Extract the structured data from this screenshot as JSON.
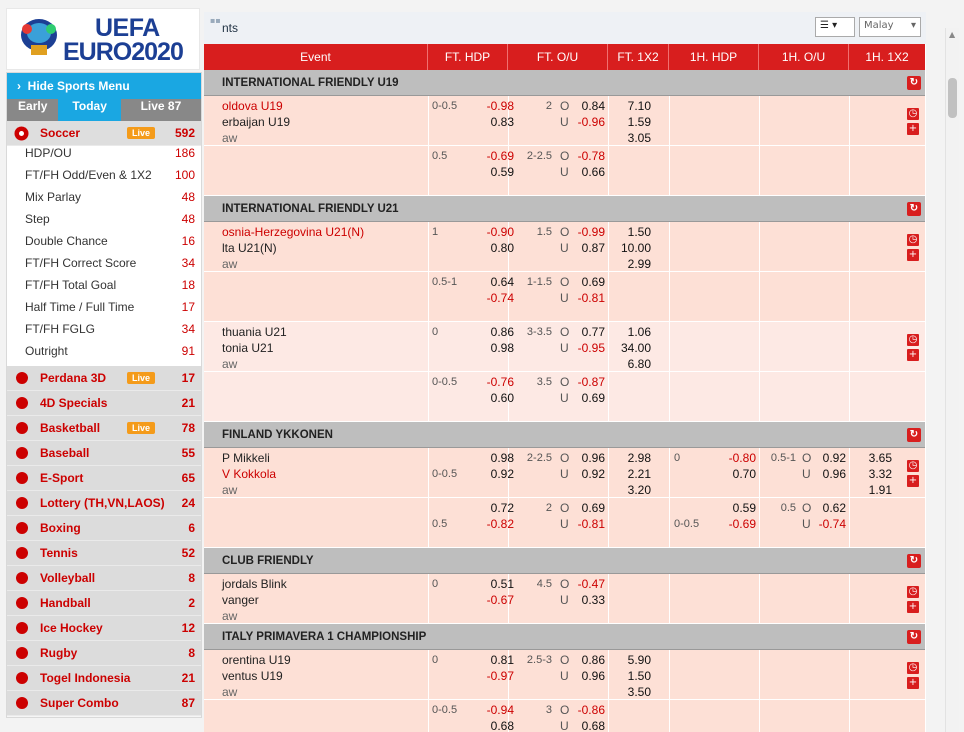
{
  "logo": {
    "line1": "UEFA",
    "line2": "EURO2020"
  },
  "sidebar": {
    "hide_label": "Hide Sports Menu",
    "tabs": [
      {
        "label": "Early"
      },
      {
        "label": "Today"
      },
      {
        "label": "Live 87"
      }
    ],
    "soccer": {
      "name": "Soccer",
      "live": "Live",
      "count": "592"
    },
    "sub": [
      {
        "label": "HDP/OU",
        "count": "186"
      },
      {
        "label": "FT/FH Odd/Even & 1X2",
        "count": "100"
      },
      {
        "label": "Mix Parlay",
        "count": "48"
      },
      {
        "label": "Step",
        "count": "48"
      },
      {
        "label": "Double Chance",
        "count": "16"
      },
      {
        "label": "FT/FH Correct Score",
        "count": "34"
      },
      {
        "label": "FT/FH Total Goal",
        "count": "18"
      },
      {
        "label": "Half Time / Full Time",
        "count": "17"
      },
      {
        "label": "FT/FH FGLG",
        "count": "34"
      },
      {
        "label": "Outright",
        "count": "91"
      }
    ],
    "sports": [
      {
        "name": "Perdana 3D",
        "live": "Live",
        "count": "17"
      },
      {
        "name": "4D Specials",
        "live": "",
        "count": "21"
      },
      {
        "name": "Basketball",
        "live": "Live",
        "count": "78"
      },
      {
        "name": "Baseball",
        "live": "",
        "count": "55"
      },
      {
        "name": "E-Sport",
        "live": "",
        "count": "65"
      },
      {
        "name": "Lottery (TH,VN,LAOS)",
        "live": "",
        "count": "24"
      },
      {
        "name": "Boxing",
        "live": "",
        "count": "6"
      },
      {
        "name": "Tennis",
        "live": "",
        "count": "52"
      },
      {
        "name": "Volleyball",
        "live": "",
        "count": "8"
      },
      {
        "name": "Handball",
        "live": "",
        "count": "2"
      },
      {
        "name": "Ice Hockey",
        "live": "",
        "count": "12"
      },
      {
        "name": "Rugby",
        "live": "",
        "count": "8"
      },
      {
        "name": "Togel Indonesia",
        "live": "",
        "count": "21"
      },
      {
        "name": "Super Combo",
        "live": "",
        "count": "87"
      }
    ]
  },
  "topbar": {
    "title": "nts",
    "odds_type": "Malay"
  },
  "columns": [
    "Event",
    "FT. HDP",
    "FT. O/U",
    "FT. 1X2",
    "1H. HDP",
    "1H. O/U",
    "1H. 1X2"
  ],
  "leagues": [
    {
      "name": "INTERNATIONAL FRIENDLY U19",
      "rows": [
        {
          "t1": "oldova U19",
          "t1fav": true,
          "t2": "erbaijan U19",
          "t3": "aw",
          "hdp": "0-0.5",
          "h1": "-0.98",
          "h2": "0.83",
          "ou": "2",
          "o1": "0.84",
          "o2": "-0.96",
          "x1": "7.10",
          "x2": "1.59",
          "x3": "3.05",
          "icons": true
        },
        {
          "t1": "",
          "t2": "",
          "t3": "",
          "hdp": "0.5",
          "h1": "-0.69",
          "h2": "0.59",
          "ou": "2-2.5",
          "o1": "-0.78",
          "o2": "0.66",
          "x1": "",
          "x2": "",
          "x3": ""
        }
      ]
    },
    {
      "name": "INTERNATIONAL FRIENDLY U21",
      "rows": [
        {
          "t1": "osnia-Herzegovina U21(N)",
          "t1fav": true,
          "t2": "lta U21(N)",
          "t3": "aw",
          "hdp": "1",
          "h1": "-0.90",
          "h2": "0.80",
          "ou": "1.5",
          "o1": "-0.99",
          "o2": "0.87",
          "x1": "1.50",
          "x2": "10.00",
          "x3": "2.99",
          "icons": true
        },
        {
          "t1": "",
          "t2": "",
          "t3": "",
          "hdp": "0.5-1",
          "h1": "0.64",
          "h2": "-0.74",
          "ou": "1-1.5",
          "o1": "0.69",
          "o2": "-0.81",
          "x1": "",
          "x2": "",
          "x3": ""
        },
        {
          "t1": "thuania U21",
          "t2": "tonia U21",
          "t3": "aw",
          "hdp": "0",
          "h1": "0.86",
          "h2": "0.98",
          "ou": "3-3.5",
          "o1": "0.77",
          "o2": "-0.95",
          "x1": "1.06",
          "x2": "34.00",
          "x3": "6.80",
          "icons": true,
          "light": true
        },
        {
          "t1": "",
          "t2": "",
          "t3": "",
          "hdp": "0-0.5",
          "h1": "-0.76",
          "h2": "0.60",
          "ou": "3.5",
          "o1": "-0.87",
          "o2": "0.69",
          "x1": "",
          "x2": "",
          "x3": "",
          "light": true
        }
      ]
    },
    {
      "name": "FINLAND YKKONEN",
      "rows": [
        {
          "t1": "P Mikkeli",
          "t2": "V Kokkola",
          "t2fav": true,
          "t3": "aw",
          "hdp2": "0-0.5",
          "h1": "0.98",
          "h2": "0.92",
          "ou": "2-2.5",
          "o1": "0.96",
          "o2": "0.92",
          "x1": "2.98",
          "x2": "2.21",
          "x3": "3.20",
          "icons": true,
          "fh": {
            "hdp": "0",
            "h1": "-0.80",
            "h2": "0.70",
            "ou": "0.5-1",
            "o1": "0.92",
            "o2": "0.96",
            "x1": "3.65",
            "x2": "3.32",
            "x3": "1.91"
          }
        },
        {
          "t1": "",
          "t2": "",
          "t3": "",
          "hdp2": "0.5",
          "h1": "0.72",
          "h2": "-0.82",
          "ou": "2",
          "o1": "0.69",
          "o2": "-0.81",
          "x1": "",
          "x2": "",
          "x3": "",
          "fh": {
            "hdp2": "0-0.5",
            "h1": "0.59",
            "h2": "-0.69",
            "ou": "0.5",
            "o1": "0.62",
            "o2": "-0.74"
          }
        }
      ]
    },
    {
      "name": "CLUB FRIENDLY",
      "rows": [
        {
          "t1": "jordals Blink",
          "t2": "vanger",
          "t3": "aw",
          "hdp": "0",
          "h1": "0.51",
          "h2": "-0.67",
          "ou": "4.5",
          "o1": "-0.47",
          "o2": "0.33",
          "x1": "",
          "x2": "",
          "x3": "",
          "icons": true
        }
      ]
    },
    {
      "name": "ITALY PRIMAVERA 1 CHAMPIONSHIP",
      "rows": [
        {
          "t1": "orentina U19",
          "t2": "ventus U19",
          "t3": "aw",
          "hdp": "0",
          "h1": "0.81",
          "h2": "-0.97",
          "ou": "2.5-3",
          "o1": "0.86",
          "o2": "0.96",
          "x1": "5.90",
          "x2": "1.50",
          "x3": "3.50",
          "icons": true
        },
        {
          "t1": "",
          "t2": "",
          "t3": "",
          "hdp": "0-0.5",
          "h1": "-0.94",
          "h2": "0.68",
          "ou": "3",
          "o1": "-0.86",
          "o2": "0.68",
          "x1": "",
          "x2": "",
          "x3": ""
        }
      ]
    }
  ]
}
